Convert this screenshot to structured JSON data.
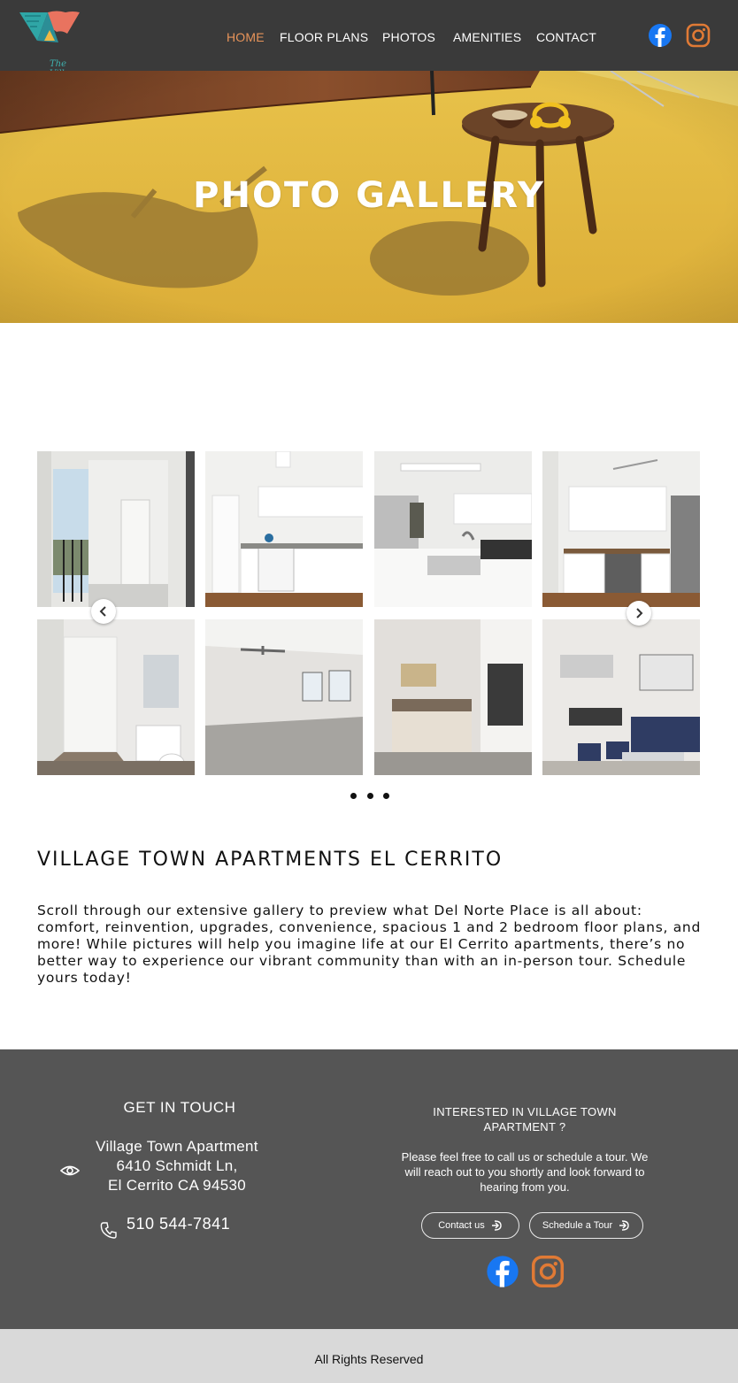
{
  "header": {
    "logo_text": "The Village",
    "nav": [
      {
        "label": "HOME",
        "active": true
      },
      {
        "label": "FLOOR PLANS",
        "active": false
      },
      {
        "label": "PHOTOS",
        "active": false
      },
      {
        "label": "AMENITIES",
        "active": false
      },
      {
        "label": "CONTACT",
        "active": false
      }
    ],
    "social": [
      "facebook-icon",
      "instagram-icon"
    ]
  },
  "hero": {
    "title": "PHOTO GALLERY"
  },
  "gallery": {
    "photos": [
      "balcony-photo",
      "kitchen-photo",
      "kitchen-sink-photo",
      "kitchen-stove-photo",
      "bathroom-photo",
      "living-room-empty-photo",
      "bedroom-photo",
      "living-dining-photo"
    ],
    "dot_count": 3,
    "prev_icon": "chevron-left-icon",
    "next_icon": "chevron-right-icon"
  },
  "about": {
    "title": "VILLAGE TOWN APARTMENTS EL CERRITO",
    "body": "Scroll through our extensive gallery to preview what Del Norte Place is all about: comfort, reinvention, upgrades, convenience, spacious 1 and 2 bedroom floor plans, and more! While pictures will help you imagine life at our El Cerrito apartments, there’s no better way to experience our vibrant community than with an in-person tour. Schedule yours today!"
  },
  "footer": {
    "get_in_touch": "GET IN TOUCH",
    "address_lines": [
      "Village Town Apartment",
      "6410 Schmidt Ln,",
      "El Cerrito CA 94530"
    ],
    "phone": "510 544-7841",
    "interested_title": "INTERESTED IN VILLAGE TOWN APARTMENT ?",
    "interested_body": "Please feel free to call us or schedule a tour. We will reach out to you shortly and look forward to hearing from you.",
    "contact_button": "Contact us",
    "tour_button": "Schedule a Tour",
    "rights": "All Rights Reserved"
  },
  "colors": {
    "header_bg": "#3a3a3a",
    "nav_active": "#e8945a",
    "footer_bg": "#555555",
    "bottom_bar": "#d9d9d9",
    "facebook": "#1877f2",
    "instagram": "#e07a35"
  }
}
